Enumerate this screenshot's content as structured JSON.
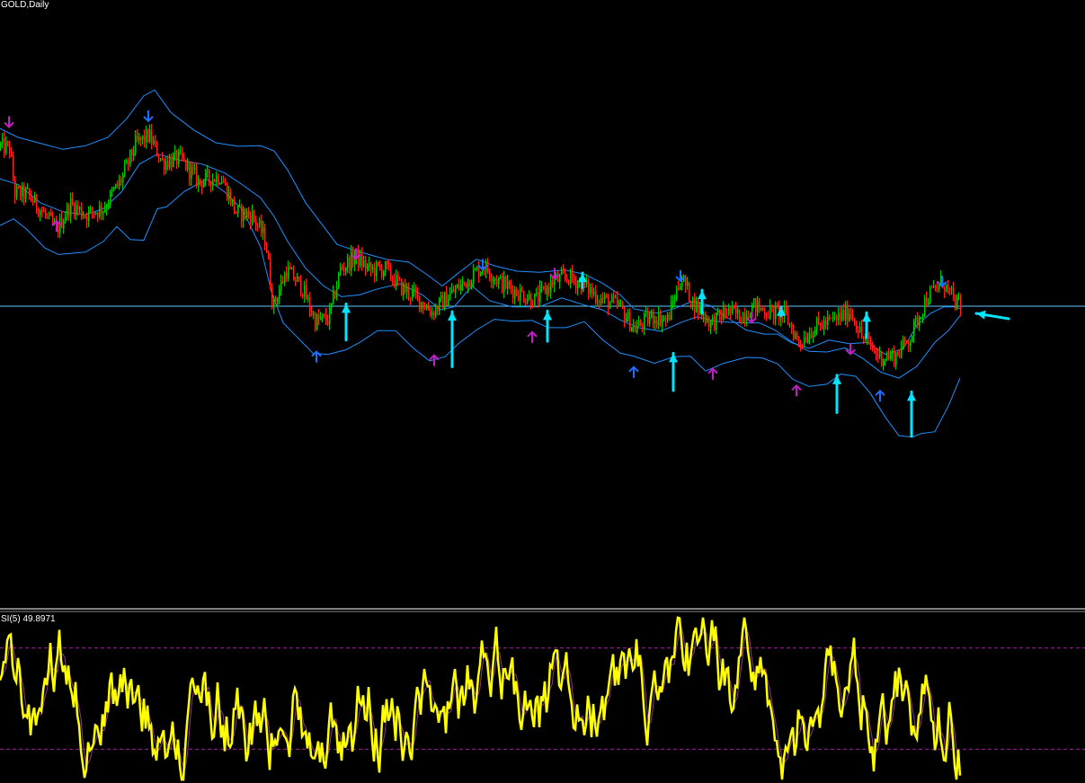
{
  "colors": {
    "background": "#000000",
    "bull_candle": "#00c800",
    "bear_candle": "#ff2020",
    "bands": "#1e90ff",
    "price_line": "#5fc8ff",
    "arrow_blue": "#1e6fff",
    "arrow_magenta": "#c21fc2",
    "annotation": "#00e5ff",
    "osc_main": "#ffff00",
    "osc_signal": "#8a3a8a",
    "osc_level": "#a020a0",
    "separator": "#ffffff"
  },
  "header": {
    "title": "GOLD,Daily"
  },
  "oscillator": {
    "label": "SI(5) 49.8971"
  },
  "chart_data": [
    {
      "type": "line",
      "title": "GOLD,Daily",
      "price_path": [
        [
          0,
          0.775
        ],
        [
          10,
          0.772
        ],
        [
          16,
          0.696
        ],
        [
          30,
          0.694
        ],
        [
          45,
          0.668
        ],
        [
          62,
          0.633
        ],
        [
          78,
          0.678
        ],
        [
          95,
          0.66
        ],
        [
          115,
          0.672
        ],
        [
          135,
          0.721
        ],
        [
          150,
          0.778
        ],
        [
          165,
          0.793
        ],
        [
          180,
          0.749
        ],
        [
          200,
          0.754
        ],
        [
          220,
          0.716
        ],
        [
          245,
          0.725
        ],
        [
          262,
          0.664
        ],
        [
          280,
          0.659
        ],
        [
          295,
          0.617
        ],
        [
          303,
          0.505
        ],
        [
          318,
          0.567
        ],
        [
          335,
          0.539
        ],
        [
          350,
          0.481
        ],
        [
          365,
          0.485
        ],
        [
          378,
          0.568
        ],
        [
          395,
          0.59
        ],
        [
          410,
          0.567
        ],
        [
          428,
          0.569
        ],
        [
          445,
          0.538
        ],
        [
          462,
          0.522
        ],
        [
          480,
          0.496
        ],
        [
          500,
          0.526
        ],
        [
          515,
          0.544
        ],
        [
          537,
          0.575
        ],
        [
          555,
          0.547
        ],
        [
          575,
          0.53
        ],
        [
          595,
          0.516
        ],
        [
          615,
          0.548
        ],
        [
          632,
          0.555
        ],
        [
          650,
          0.54
        ],
        [
          668,
          0.518
        ],
        [
          688,
          0.506
        ],
        [
          705,
          0.468
        ],
        [
          725,
          0.489
        ],
        [
          742,
          0.483
        ],
        [
          757,
          0.556
        ],
        [
          770,
          0.513
        ],
        [
          790,
          0.477
        ],
        [
          808,
          0.498
        ],
        [
          822,
          0.489
        ],
        [
          838,
          0.506
        ],
        [
          855,
          0.496
        ],
        [
          872,
          0.493
        ],
        [
          888,
          0.445
        ],
        [
          905,
          0.47
        ],
        [
          925,
          0.481
        ],
        [
          946,
          0.498
        ],
        [
          958,
          0.455
        ],
        [
          978,
          0.421
        ],
        [
          995,
          0.422
        ],
        [
          1012,
          0.454
        ],
        [
          1030,
          0.52
        ],
        [
          1048,
          0.547
        ],
        [
          1060,
          0.516
        ],
        [
          1068,
          0.504
        ]
      ],
      "upper_band": [
        [
          0,
          0.805
        ],
        [
          20,
          0.79
        ],
        [
          45,
          0.78
        ],
        [
          70,
          0.77
        ],
        [
          95,
          0.776
        ],
        [
          120,
          0.79
        ],
        [
          140,
          0.82
        ],
        [
          160,
          0.86
        ],
        [
          172,
          0.87
        ],
        [
          190,
          0.832
        ],
        [
          215,
          0.803
        ],
        [
          240,
          0.781
        ],
        [
          265,
          0.775
        ],
        [
          290,
          0.776
        ],
        [
          305,
          0.767
        ],
        [
          320,
          0.735
        ],
        [
          340,
          0.68
        ],
        [
          360,
          0.64
        ],
        [
          375,
          0.61
        ],
        [
          392,
          0.601
        ],
        [
          410,
          0.593
        ],
        [
          430,
          0.585
        ],
        [
          455,
          0.58
        ],
        [
          475,
          0.559
        ],
        [
          492,
          0.54
        ],
        [
          510,
          0.562
        ],
        [
          530,
          0.585
        ],
        [
          550,
          0.574
        ],
        [
          575,
          0.565
        ],
        [
          600,
          0.563
        ],
        [
          628,
          0.567
        ],
        [
          650,
          0.56
        ],
        [
          670,
          0.545
        ],
        [
          690,
          0.525
        ],
        [
          705,
          0.502
        ],
        [
          730,
          0.494
        ],
        [
          750,
          0.502
        ],
        [
          770,
          0.514
        ],
        [
          790,
          0.507
        ],
        [
          808,
          0.488
        ],
        [
          830,
          0.466
        ],
        [
          850,
          0.459
        ],
        [
          865,
          0.459
        ],
        [
          880,
          0.445
        ],
        [
          900,
          0.435
        ],
        [
          922,
          0.449
        ],
        [
          945,
          0.443
        ],
        [
          965,
          0.445
        ],
        [
          985,
          0.425
        ],
        [
          1005,
          0.435
        ],
        [
          1020,
          0.474
        ],
        [
          1035,
          0.494
        ],
        [
          1050,
          0.505
        ],
        [
          1062,
          0.505
        ],
        [
          1068,
          0.502
        ]
      ],
      "middle_band": [
        [
          0,
          0.72
        ],
        [
          20,
          0.711
        ],
        [
          45,
          0.68
        ],
        [
          70,
          0.665
        ],
        [
          95,
          0.66
        ],
        [
          115,
          0.67
        ],
        [
          135,
          0.698
        ],
        [
          155,
          0.745
        ],
        [
          175,
          0.762
        ],
        [
          200,
          0.752
        ],
        [
          225,
          0.745
        ],
        [
          250,
          0.73
        ],
        [
          270,
          0.71
        ],
        [
          290,
          0.688
        ],
        [
          305,
          0.657
        ],
        [
          320,
          0.615
        ],
        [
          340,
          0.57
        ],
        [
          360,
          0.54
        ],
        [
          380,
          0.522
        ],
        [
          400,
          0.525
        ],
        [
          420,
          0.535
        ],
        [
          445,
          0.544
        ],
        [
          470,
          0.525
        ],
        [
          490,
          0.5
        ],
        [
          505,
          0.505
        ],
        [
          525,
          0.54
        ],
        [
          545,
          0.515
        ],
        [
          570,
          0.505
        ],
        [
          600,
          0.505
        ],
        [
          625,
          0.52
        ],
        [
          650,
          0.508
        ],
        [
          670,
          0.5
        ],
        [
          690,
          0.483
        ],
        [
          710,
          0.47
        ],
        [
          735,
          0.464
        ],
        [
          760,
          0.48
        ],
        [
          775,
          0.488
        ],
        [
          800,
          0.48
        ],
        [
          825,
          0.478
        ],
        [
          845,
          0.478
        ],
        [
          862,
          0.466
        ],
        [
          880,
          0.447
        ],
        [
          900,
          0.43
        ],
        [
          920,
          0.429
        ],
        [
          940,
          0.436
        ],
        [
          960,
          0.418
        ],
        [
          980,
          0.395
        ],
        [
          1000,
          0.385
        ],
        [
          1020,
          0.405
        ],
        [
          1040,
          0.445
        ],
        [
          1055,
          0.465
        ],
        [
          1068,
          0.49
        ]
      ],
      "lower_band": [
        [
          0,
          0.642
        ],
        [
          15,
          0.653
        ],
        [
          30,
          0.635
        ],
        [
          50,
          0.604
        ],
        [
          65,
          0.593
        ],
        [
          95,
          0.597
        ],
        [
          115,
          0.615
        ],
        [
          130,
          0.64
        ],
        [
          145,
          0.618
        ],
        [
          160,
          0.617
        ],
        [
          175,
          0.67
        ],
        [
          185,
          0.673
        ],
        [
          205,
          0.699
        ],
        [
          230,
          0.72
        ],
        [
          250,
          0.698
        ],
        [
          270,
          0.668
        ],
        [
          290,
          0.605
        ],
        [
          302,
          0.53
        ],
        [
          315,
          0.478
        ],
        [
          330,
          0.455
        ],
        [
          348,
          0.427
        ],
        [
          365,
          0.425
        ],
        [
          385,
          0.433
        ],
        [
          400,
          0.445
        ],
        [
          420,
          0.465
        ],
        [
          440,
          0.465
        ],
        [
          460,
          0.435
        ],
        [
          478,
          0.414
        ],
        [
          495,
          0.421
        ],
        [
          510,
          0.443
        ],
        [
          530,
          0.466
        ],
        [
          550,
          0.484
        ],
        [
          570,
          0.481
        ],
        [
          592,
          0.482
        ],
        [
          610,
          0.47
        ],
        [
          630,
          0.47
        ],
        [
          650,
          0.48
        ],
        [
          670,
          0.45
        ],
        [
          690,
          0.427
        ],
        [
          705,
          0.422
        ],
        [
          728,
          0.41
        ],
        [
          750,
          0.421
        ],
        [
          768,
          0.422
        ],
        [
          785,
          0.397
        ],
        [
          805,
          0.41
        ],
        [
          830,
          0.42
        ],
        [
          848,
          0.419
        ],
        [
          865,
          0.409
        ],
        [
          882,
          0.383
        ],
        [
          900,
          0.371
        ],
        [
          920,
          0.375
        ],
        [
          935,
          0.392
        ],
        [
          952,
          0.388
        ],
        [
          968,
          0.36
        ],
        [
          985,
          0.319
        ],
        [
          1000,
          0.288
        ],
        [
          1015,
          0.286
        ],
        [
          1025,
          0.292
        ],
        [
          1040,
          0.295
        ],
        [
          1055,
          0.338
        ],
        [
          1068,
          0.385
        ]
      ],
      "horizontal_line_level": 0.506,
      "markers_down_blue": [
        [
          165,
          0.825
        ],
        [
          537,
          0.575
        ],
        [
          757,
          0.556
        ],
        [
          1048,
          0.547
        ]
      ],
      "markers_down_magenta": [
        [
          10,
          0.815
        ],
        [
          396,
          0.593
        ],
        [
          617,
          0.56
        ],
        [
          836,
          0.486
        ],
        [
          946,
          0.433
        ]
      ],
      "markers_up_blue": [
        [
          352,
          0.422
        ],
        [
          705,
          0.396
        ],
        [
          979,
          0.356
        ]
      ],
      "markers_up_magenta": [
        [
          63,
          0.642
        ],
        [
          483,
          0.416
        ],
        [
          592,
          0.455
        ],
        [
          793,
          0.393
        ],
        [
          886,
          0.365
        ]
      ],
      "annotation_up_arrows": [
        [
          385,
          0.449,
          0.51
        ],
        [
          503,
          0.404,
          0.497
        ],
        [
          609,
          0.447,
          0.498
        ],
        [
          749,
          0.364,
          0.427
        ],
        [
          931,
          0.327,
          0.39
        ],
        [
          1014,
          0.287,
          0.362
        ]
      ],
      "annotation_down_arrows": [
        [
          648,
          0.537,
          0.562
        ],
        [
          781,
          0.494,
          0.533
        ],
        [
          869,
          0.49,
          0.505
        ],
        [
          964,
          0.453,
          0.495
        ]
      ],
      "annotation_left_arrow": [
        1122,
        0.485,
        1086,
        0.494
      ]
    },
    {
      "type": "line",
      "series_main_seed": 7,
      "levels": [
        80,
        20
      ]
    }
  ]
}
